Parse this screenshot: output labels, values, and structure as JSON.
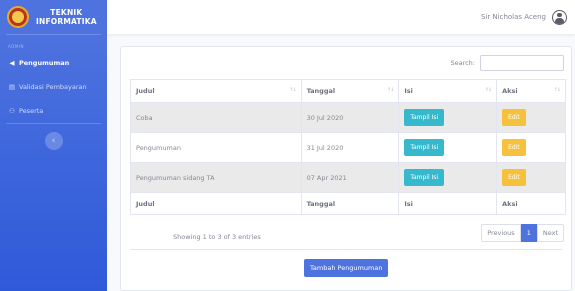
{
  "sidebar": {
    "brand_line1": "TEKNIK",
    "brand_line2": "INFORMATIKA",
    "heading": "ADMIN",
    "items": [
      {
        "label": "Pengumuman",
        "icon": "megaphone-icon"
      },
      {
        "label": "Validasi Pembayaran",
        "icon": "table-icon"
      },
      {
        "label": "Peserta",
        "icon": "users-icon"
      }
    ],
    "toggle_glyph": "‹"
  },
  "topbar": {
    "username": "Sir Nicholas Aceng"
  },
  "search": {
    "label": "Search:",
    "value": ""
  },
  "table": {
    "headers": [
      "Judul",
      "Tanggal",
      "Isi",
      "Aksi"
    ],
    "sort_glyph": "↑↓",
    "rows": [
      {
        "judul": "Coba",
        "tanggal": "30 Jul 2020",
        "isi_button": "Tampil Isi",
        "aksi_button": "Edit"
      },
      {
        "judul": "Pengumuman",
        "tanggal": "31 Jul 2020",
        "isi_button": "Tampil Isi",
        "aksi_button": "Edit"
      },
      {
        "judul": "Pengumuman sidang TA",
        "tanggal": "07 Apr 2021",
        "isi_button": "Tampil Isi",
        "aksi_button": "Edit"
      }
    ],
    "footers": [
      "Judul",
      "Tanggal",
      "Isi",
      "Aksi"
    ]
  },
  "info": "Showing 1 to 3 of 3 entries",
  "pagination": {
    "previous": "Previous",
    "current": "1",
    "next": "Next"
  },
  "add_button": "Tambah Pengumuman",
  "colors": {
    "primary": "#4e73df",
    "info": "#36b9cc",
    "warning": "#f6c23e"
  }
}
